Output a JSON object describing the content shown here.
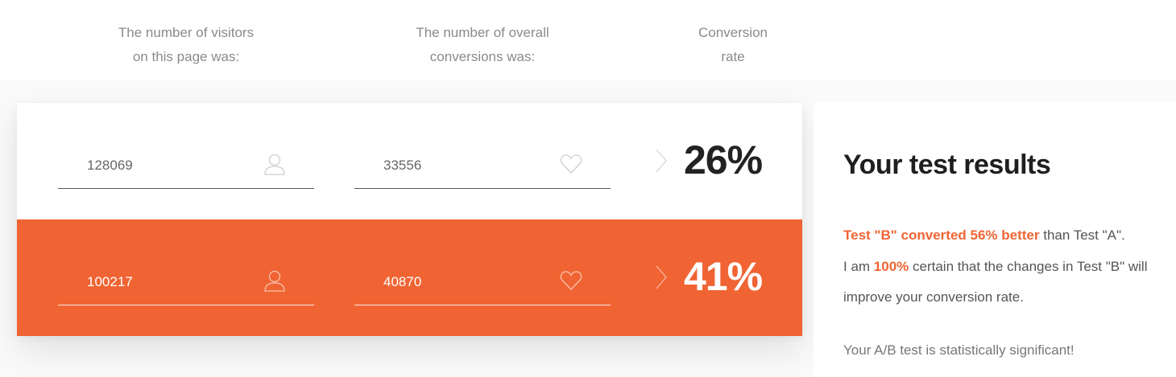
{
  "headers": {
    "visitors": "The number of visitors\non this page was:",
    "conversions": "The number of overall\nconversions was:",
    "rate": "Conversion\nrate"
  },
  "tests": [
    {
      "visitors": "128069",
      "conversions": "33556",
      "rate": "26%"
    },
    {
      "visitors": "100217",
      "conversions": "40870",
      "rate": "41%"
    }
  ],
  "icons": {
    "visitors": "user-icon",
    "conversions": "heart-icon",
    "separator": "chevron-right-icon"
  },
  "results": {
    "title": "Your test results",
    "highlight_1": "Test \"B\" converted 56% better",
    "text_1": " than Test \"A\".",
    "text_2": "I am ",
    "highlight_2": "100%",
    "text_3": " certain that the changes in Test \"B\" will improve your conversion rate.",
    "significance": "Your A/B test is statistically significant!"
  },
  "colors": {
    "accent": "#f06433",
    "text": "#555555",
    "heading": "#1f1f1f"
  }
}
